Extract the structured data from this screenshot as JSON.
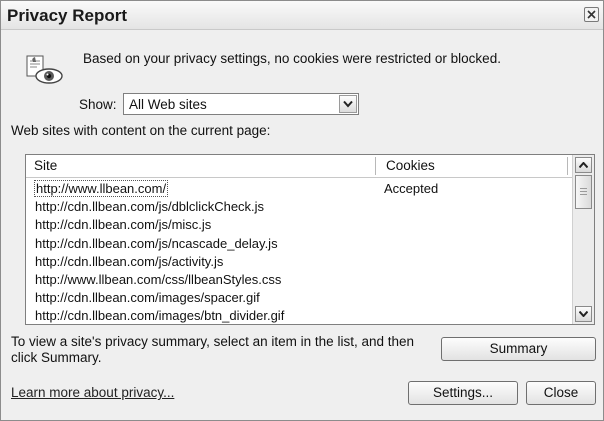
{
  "window": {
    "title": "Privacy Report",
    "close_icon": "close-icon"
  },
  "info": {
    "icon": "privacy-eye-icon",
    "message": "Based on your privacy settings, no cookies were restricted or blocked."
  },
  "filter": {
    "label": "Show:",
    "selected": "All Web sites"
  },
  "list": {
    "caption": "Web sites with content on the current page:",
    "columns": [
      "Site",
      "Cookies"
    ],
    "rows": [
      {
        "site": "http://www.llbean.com/",
        "cookies": "Accepted"
      },
      {
        "site": "http://cdn.llbean.com/js/dblclickCheck.js",
        "cookies": ""
      },
      {
        "site": "http://cdn.llbean.com/js/misc.js",
        "cookies": ""
      },
      {
        "site": "http://cdn.llbean.com/js/ncascade_delay.js",
        "cookies": ""
      },
      {
        "site": "http://cdn.llbean.com/js/activity.js",
        "cookies": ""
      },
      {
        "site": "http://www.llbean.com/css/llbeanStyles.css",
        "cookies": ""
      },
      {
        "site": "http://cdn.llbean.com/images/spacer.gif",
        "cookies": ""
      },
      {
        "site": "http://cdn.llbean.com/images/btn_divider.gif",
        "cookies": ""
      }
    ]
  },
  "footer": {
    "help_text": "To view a site's privacy summary, select an item in the list, and then click Summary.",
    "summary_label": "Summary",
    "learn_more_label": "Learn more about privacy...",
    "settings_label": "Settings...",
    "close_label": "Close"
  }
}
